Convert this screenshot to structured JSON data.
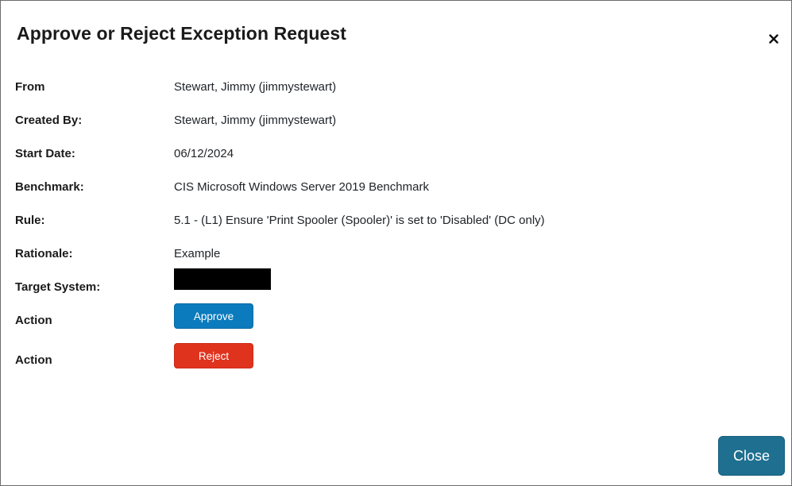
{
  "modal": {
    "title": "Approve or Reject Exception Request",
    "close_icon": "close-icon"
  },
  "fields": {
    "from": {
      "label": "From",
      "value": "Stewart, Jimmy (jimmystewart)"
    },
    "created_by": {
      "label": "Created By:",
      "value": "Stewart, Jimmy (jimmystewart)"
    },
    "start_date": {
      "label": "Start Date:",
      "value": "06/12/2024"
    },
    "benchmark": {
      "label": "Benchmark:",
      "value": "CIS Microsoft Windows Server 2019 Benchmark"
    },
    "rule": {
      "label": "Rule:",
      "value": "5.1 - (L1) Ensure 'Print Spooler (Spooler)' is set to 'Disabled' (DC only)"
    },
    "rationale": {
      "label": "Rationale:",
      "value": "Example"
    },
    "target_system": {
      "label": "Target System:"
    }
  },
  "actions": {
    "approve": {
      "label": "Action",
      "button": "Approve"
    },
    "reject": {
      "label": "Action",
      "button": "Reject"
    }
  },
  "footer": {
    "close_button": "Close"
  },
  "colors": {
    "approve": "#0b7bbd",
    "reject": "#e0331e",
    "close": "#1e6f90"
  }
}
